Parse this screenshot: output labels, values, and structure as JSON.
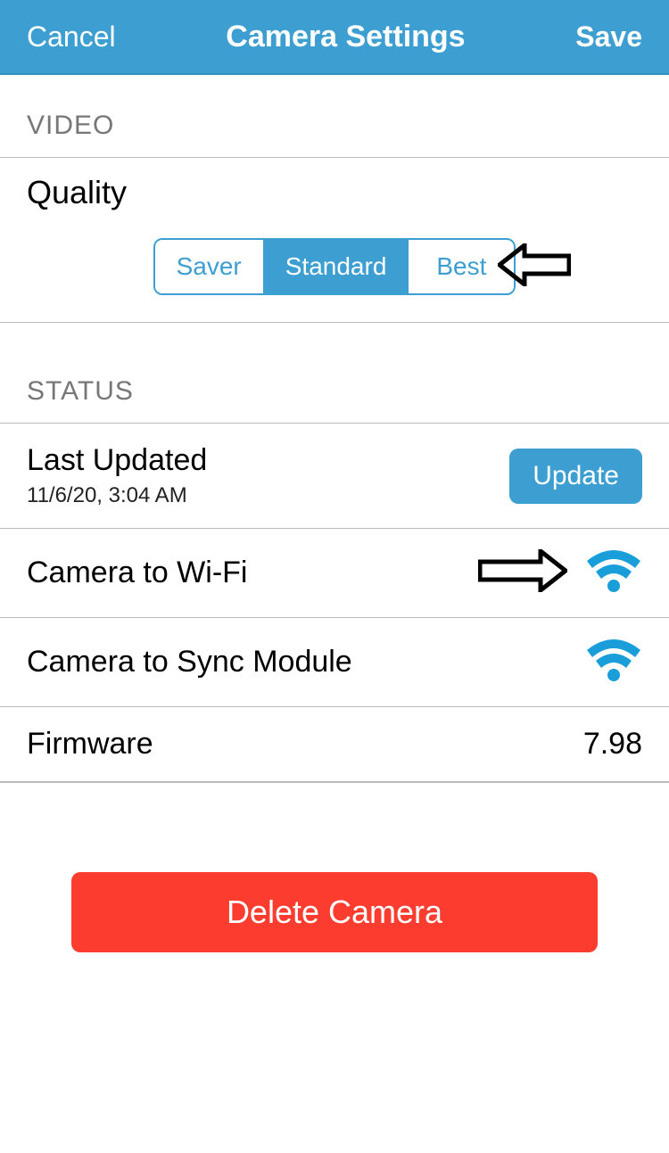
{
  "navbar": {
    "cancel": "Cancel",
    "title": "Camera Settings",
    "save": "Save"
  },
  "video": {
    "header": "VIDEO",
    "quality_label": "Quality",
    "segments": {
      "saver": "Saver",
      "standard": "Standard",
      "best": "Best"
    },
    "selected": "Standard"
  },
  "status": {
    "header": "STATUS",
    "last_updated_label": "Last Updated",
    "last_updated_value": "11/6/20, 3:04 AM",
    "update_label": "Update",
    "camera_wifi_label": "Camera to Wi-Fi",
    "camera_sync_label": "Camera to Sync Module",
    "firmware_label": "Firmware",
    "firmware_value": "7.98"
  },
  "delete_label": "Delete Camera",
  "colors": {
    "brand": "#3d9fd1",
    "danger": "#fb3c2f"
  }
}
